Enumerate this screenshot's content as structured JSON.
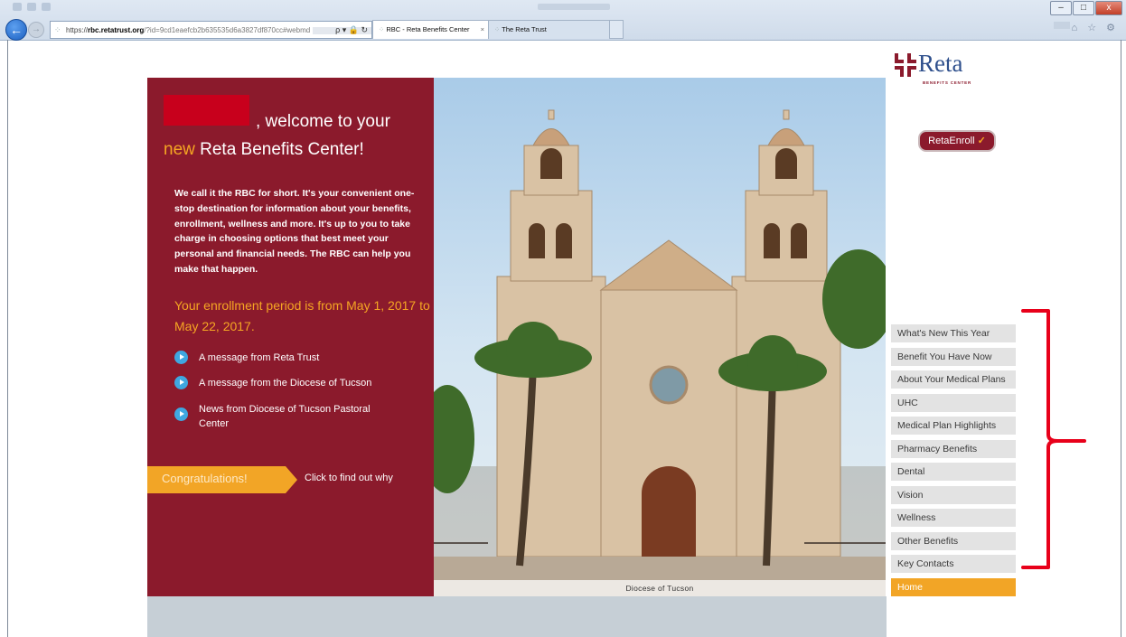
{
  "browser": {
    "url_prefix": "https://",
    "url_domain": "rbc.retatrust.org",
    "url_rest": "/?id=9cd1eaefcb2b635535d6a3827df870cc#webmd",
    "address_tools": "ρ ▾ 🔒 ↻",
    "tabs": [
      {
        "label": "RBC - Reta Benefits Center",
        "close": "×"
      },
      {
        "label": "The Reta Trust"
      }
    ],
    "nav_back": "←",
    "nav_forward": "→",
    "window_buttons": {
      "minimize": "–",
      "maximize": "□",
      "close": "x"
    },
    "toolbar_icons": "⌂ ☆ ⚙"
  },
  "hero": {
    "welcome_suffix": ", welcome to your",
    "welcome_new": "new",
    "welcome_rest": " Reta Benefits Center!",
    "intro": "We call it the RBC for short. It's your convenient one-stop destination for information about your benefits, enrollment, wellness and more. It's up to you to take charge in choosing options that best meet your personal and financial needs. The RBC can help you make that happen.",
    "enrollment_period": "Your enrollment period is from May 1, 2017 to May 22, 2017.",
    "messages": [
      {
        "label": "A message from Reta Trust"
      },
      {
        "label": "A message from the Diocese of Tucson"
      },
      {
        "label": "News from Diocese of Tucson Pastoral Center"
      }
    ],
    "congrats_label": "Congratulations!",
    "findout_label": "Click to find out why"
  },
  "photo": {
    "caption": "Diocese of Tucson"
  },
  "logo": {
    "word": "Reta",
    "sub": "BENEFITS CENTER"
  },
  "retaenroll": {
    "label": "RetaEnroll",
    "check": "✓"
  },
  "menu": {
    "items": [
      {
        "label": "What's New This Year"
      },
      {
        "label": "Benefit You Have Now"
      },
      {
        "label": "About Your Medical Plans"
      },
      {
        "label": "UHC"
      },
      {
        "label": "Medical Plan Highlights"
      },
      {
        "label": "Pharmacy Benefits"
      },
      {
        "label": "Dental"
      },
      {
        "label": "Vision"
      },
      {
        "label": "Wellness"
      },
      {
        "label": "Other Benefits"
      },
      {
        "label": "Key Contacts"
      },
      {
        "label": "Home"
      }
    ]
  },
  "colors": {
    "maroon": "#8b1a2c",
    "orange": "#f2a526",
    "annotation_red": "#e8001a",
    "menu_grey": "#e3e3e3",
    "play_blue": "#3fa7e0"
  }
}
